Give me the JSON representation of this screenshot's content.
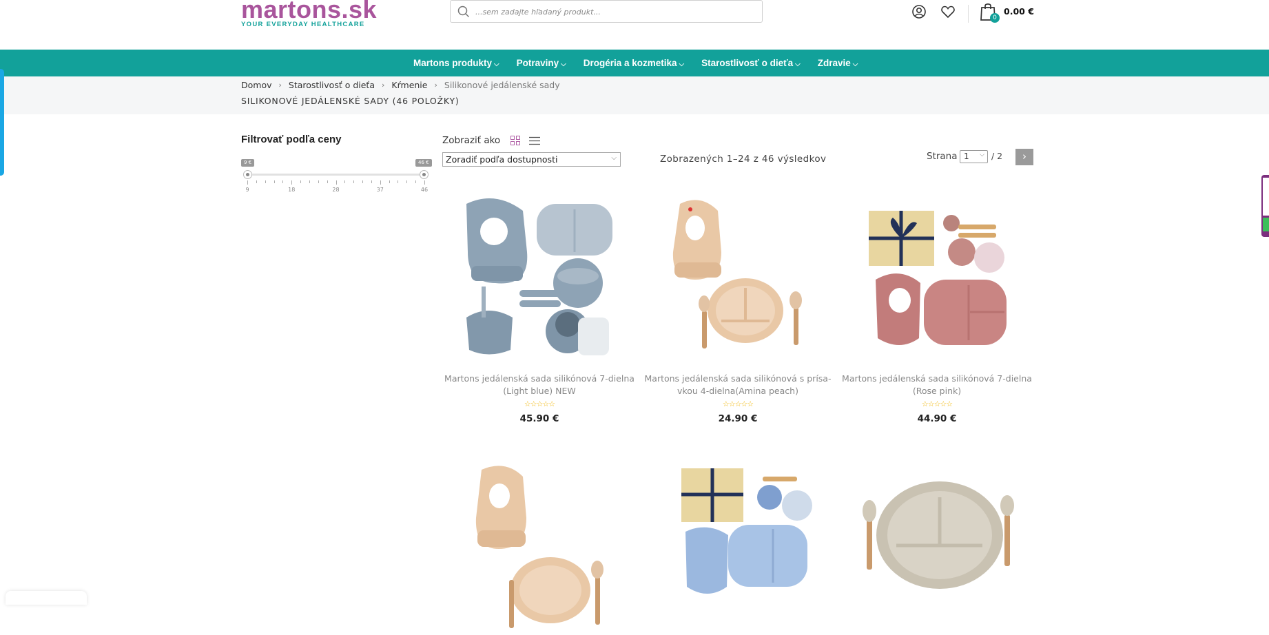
{
  "header": {
    "logo_brand": "martons.sk",
    "logo_tagline": "YOUR EVERYDAY HEALTHCARE",
    "search_placeholder": "...sem zadajte hľadaný produkt...",
    "cart_count": "0",
    "cart_total": "0.00 €",
    "icons": [
      "user-icon",
      "heart-icon",
      "shopping-bag-icon",
      "search-icon"
    ]
  },
  "nav": {
    "items": [
      {
        "label": "Martons produkty"
      },
      {
        "label": "Potraviny"
      },
      {
        "label": "Drogéria a kozmetika"
      },
      {
        "label": "Starostlivosť o dieťa"
      },
      {
        "label": "Zdravie"
      }
    ]
  },
  "breadcrumb": {
    "items": [
      "Domov",
      "Starostlivosť o dieťa",
      "Kŕmenie"
    ],
    "current": "Silikonové jedálenské sady"
  },
  "page_title": "SILIKONOVÉ JEDÁLENSKÉ SADY (46 POLOŽKY)",
  "filter": {
    "title": "Filtrovať podľa ceny",
    "min_tag": "9 €",
    "max_tag": "46 €",
    "min": 9,
    "max": 46,
    "tick_labels": [
      "9",
      "18",
      "28",
      "37",
      "46"
    ]
  },
  "toolbar": {
    "view_label": "Zobraziť ako",
    "sort_selected": "Zoradiť podľa dostupnosti",
    "results_text": "Zobrazených 1–24 z 46 výsledkov",
    "page_label": "Strana",
    "page_current": "1",
    "page_total": "/ 2",
    "next_label": "›"
  },
  "products": [
    {
      "title": "Martons jedálenská sada silikónová 7-dielna (Light blue) NEW",
      "price": "45.90 €",
      "stars": "☆☆☆☆☆"
    },
    {
      "title": "Martons jedálenská sada silikónová s prísa­vkou 4-dielna(Amina peach)",
      "price": "24.90 €",
      "stars": "☆☆☆☆☆"
    },
    {
      "title": "Martons jedálenská sada silikónová 7-dielna (Rose pink)",
      "price": "44.90 €",
      "stars": "☆☆☆☆☆"
    },
    {
      "title": "",
      "price": "",
      "stars": ""
    },
    {
      "title": "",
      "price": "",
      "stars": ""
    },
    {
      "title": "",
      "price": "",
      "stars": ""
    }
  ],
  "colors": {
    "brand_purple": "#a9559c",
    "brand_teal": "#12a19a",
    "star": "#f0b400"
  }
}
